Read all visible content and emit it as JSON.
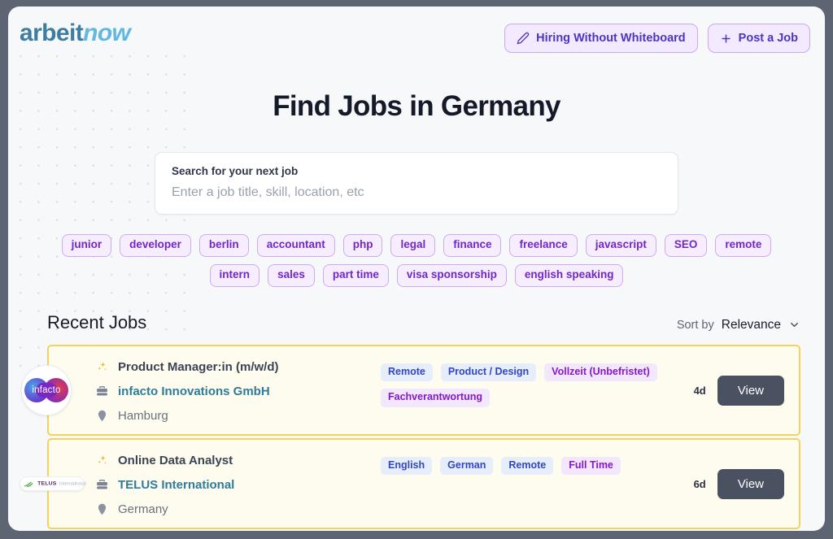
{
  "brand": {
    "name_primary": "arbeit",
    "name_secondary": "now"
  },
  "header": {
    "buttons": [
      {
        "label": "Hiring Without Whiteboard",
        "icon": "pencil-icon"
      },
      {
        "label": "Post a Job",
        "icon": "plus-icon"
      }
    ]
  },
  "hero": {
    "title": "Find Jobs in Germany",
    "search": {
      "label": "Search for your next job",
      "value": "",
      "placeholder": "Enter a job title, skill, location, etc"
    }
  },
  "tags": [
    "junior",
    "developer",
    "berlin",
    "accountant",
    "php",
    "legal",
    "finance",
    "freelance",
    "javascript",
    "SEO",
    "remote",
    "intern",
    "sales",
    "part time",
    "visa sponsorship",
    "english speaking"
  ],
  "jobs_section": {
    "title": "Recent Jobs",
    "sort": {
      "label": "Sort by",
      "value": "Relevance",
      "icon": "chevron-down-icon"
    },
    "view_label": "View",
    "jobs": [
      {
        "logo_type": "infacto",
        "logo_text": "infacto",
        "role": "Product Manager:in (m/w/d)",
        "company": "infacto Innovations GmbH",
        "location": "Hamburg",
        "posted": "4d",
        "badges": [
          {
            "label": "Remote",
            "color": "blue"
          },
          {
            "label": "Product / Design",
            "color": "blue"
          },
          {
            "label": "Vollzeit (Unbefristet)",
            "color": "purple"
          },
          {
            "label": "Fachverantwortung",
            "color": "purple"
          }
        ]
      },
      {
        "logo_type": "telus",
        "logo_text": "TELUS",
        "logo_subtext": "International",
        "role": "Online Data Analyst",
        "company": "TELUS International",
        "location": "Germany",
        "posted": "6d",
        "badges": [
          {
            "label": "English",
            "color": "blue"
          },
          {
            "label": "German",
            "color": "blue"
          },
          {
            "label": "Remote",
            "color": "blue"
          },
          {
            "label": "Full Time",
            "color": "purple"
          }
        ]
      }
    ]
  },
  "colors": {
    "brand_primary": "#3d7da0",
    "brand_secondary": "#62b9e0",
    "accent_purple": "#7226c9",
    "card_border": "#f2d35b",
    "card_background": "#fdfcef",
    "view_button": "#4a5161",
    "badge_blue_text": "#3246c0",
    "badge_purple_text": "#8518c8"
  }
}
